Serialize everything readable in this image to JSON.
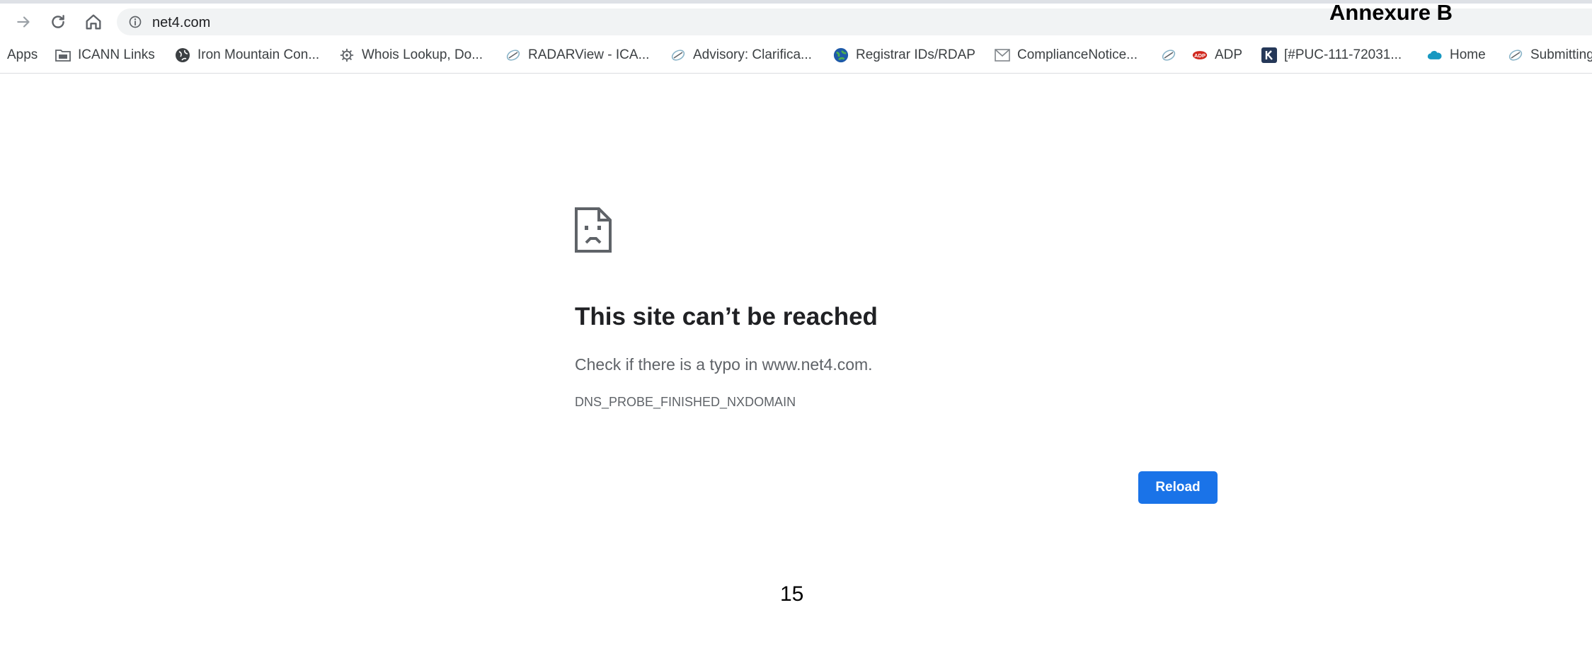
{
  "browser": {
    "url": "net4.com",
    "bookmarks": [
      {
        "label": "Apps",
        "icon": "none"
      },
      {
        "label": "ICANN Links",
        "icon": "folder-icon"
      },
      {
        "label": "Iron Mountain Con...",
        "icon": "globe-icon"
      },
      {
        "label": "Whois Lookup, Do...",
        "icon": "gear-icon"
      },
      {
        "label": "RADARView - ICA...",
        "icon": "icann-icon"
      },
      {
        "label": "Advisory: Clarifica...",
        "icon": "icann-icon"
      },
      {
        "label": "Registrar IDs/RDAP",
        "icon": "globe-icon"
      },
      {
        "label": "ComplianceNotice...",
        "icon": "mail-icon"
      },
      {
        "label": "",
        "icon": "icann-icon"
      },
      {
        "label": "ADP",
        "icon": "adp-icon"
      },
      {
        "label": "[#PUC-111-72031...",
        "icon": "k-icon"
      },
      {
        "label": "Home",
        "icon": "cloud-icon"
      },
      {
        "label": "Submitting",
        "icon": "icann-icon"
      }
    ]
  },
  "annotation": {
    "label": "Annexure B"
  },
  "error": {
    "title": "This site can’t be reached",
    "message": "Check if there is a typo in www.net4.com.",
    "code": "DNS_PROBE_FINISHED_NXDOMAIN",
    "reload_label": "Reload"
  },
  "footer": {
    "page_number": "15"
  },
  "colors": {
    "accent": "#1a73e8",
    "omnibox_bg": "#f1f3f4",
    "text_secondary": "#5f6368"
  }
}
